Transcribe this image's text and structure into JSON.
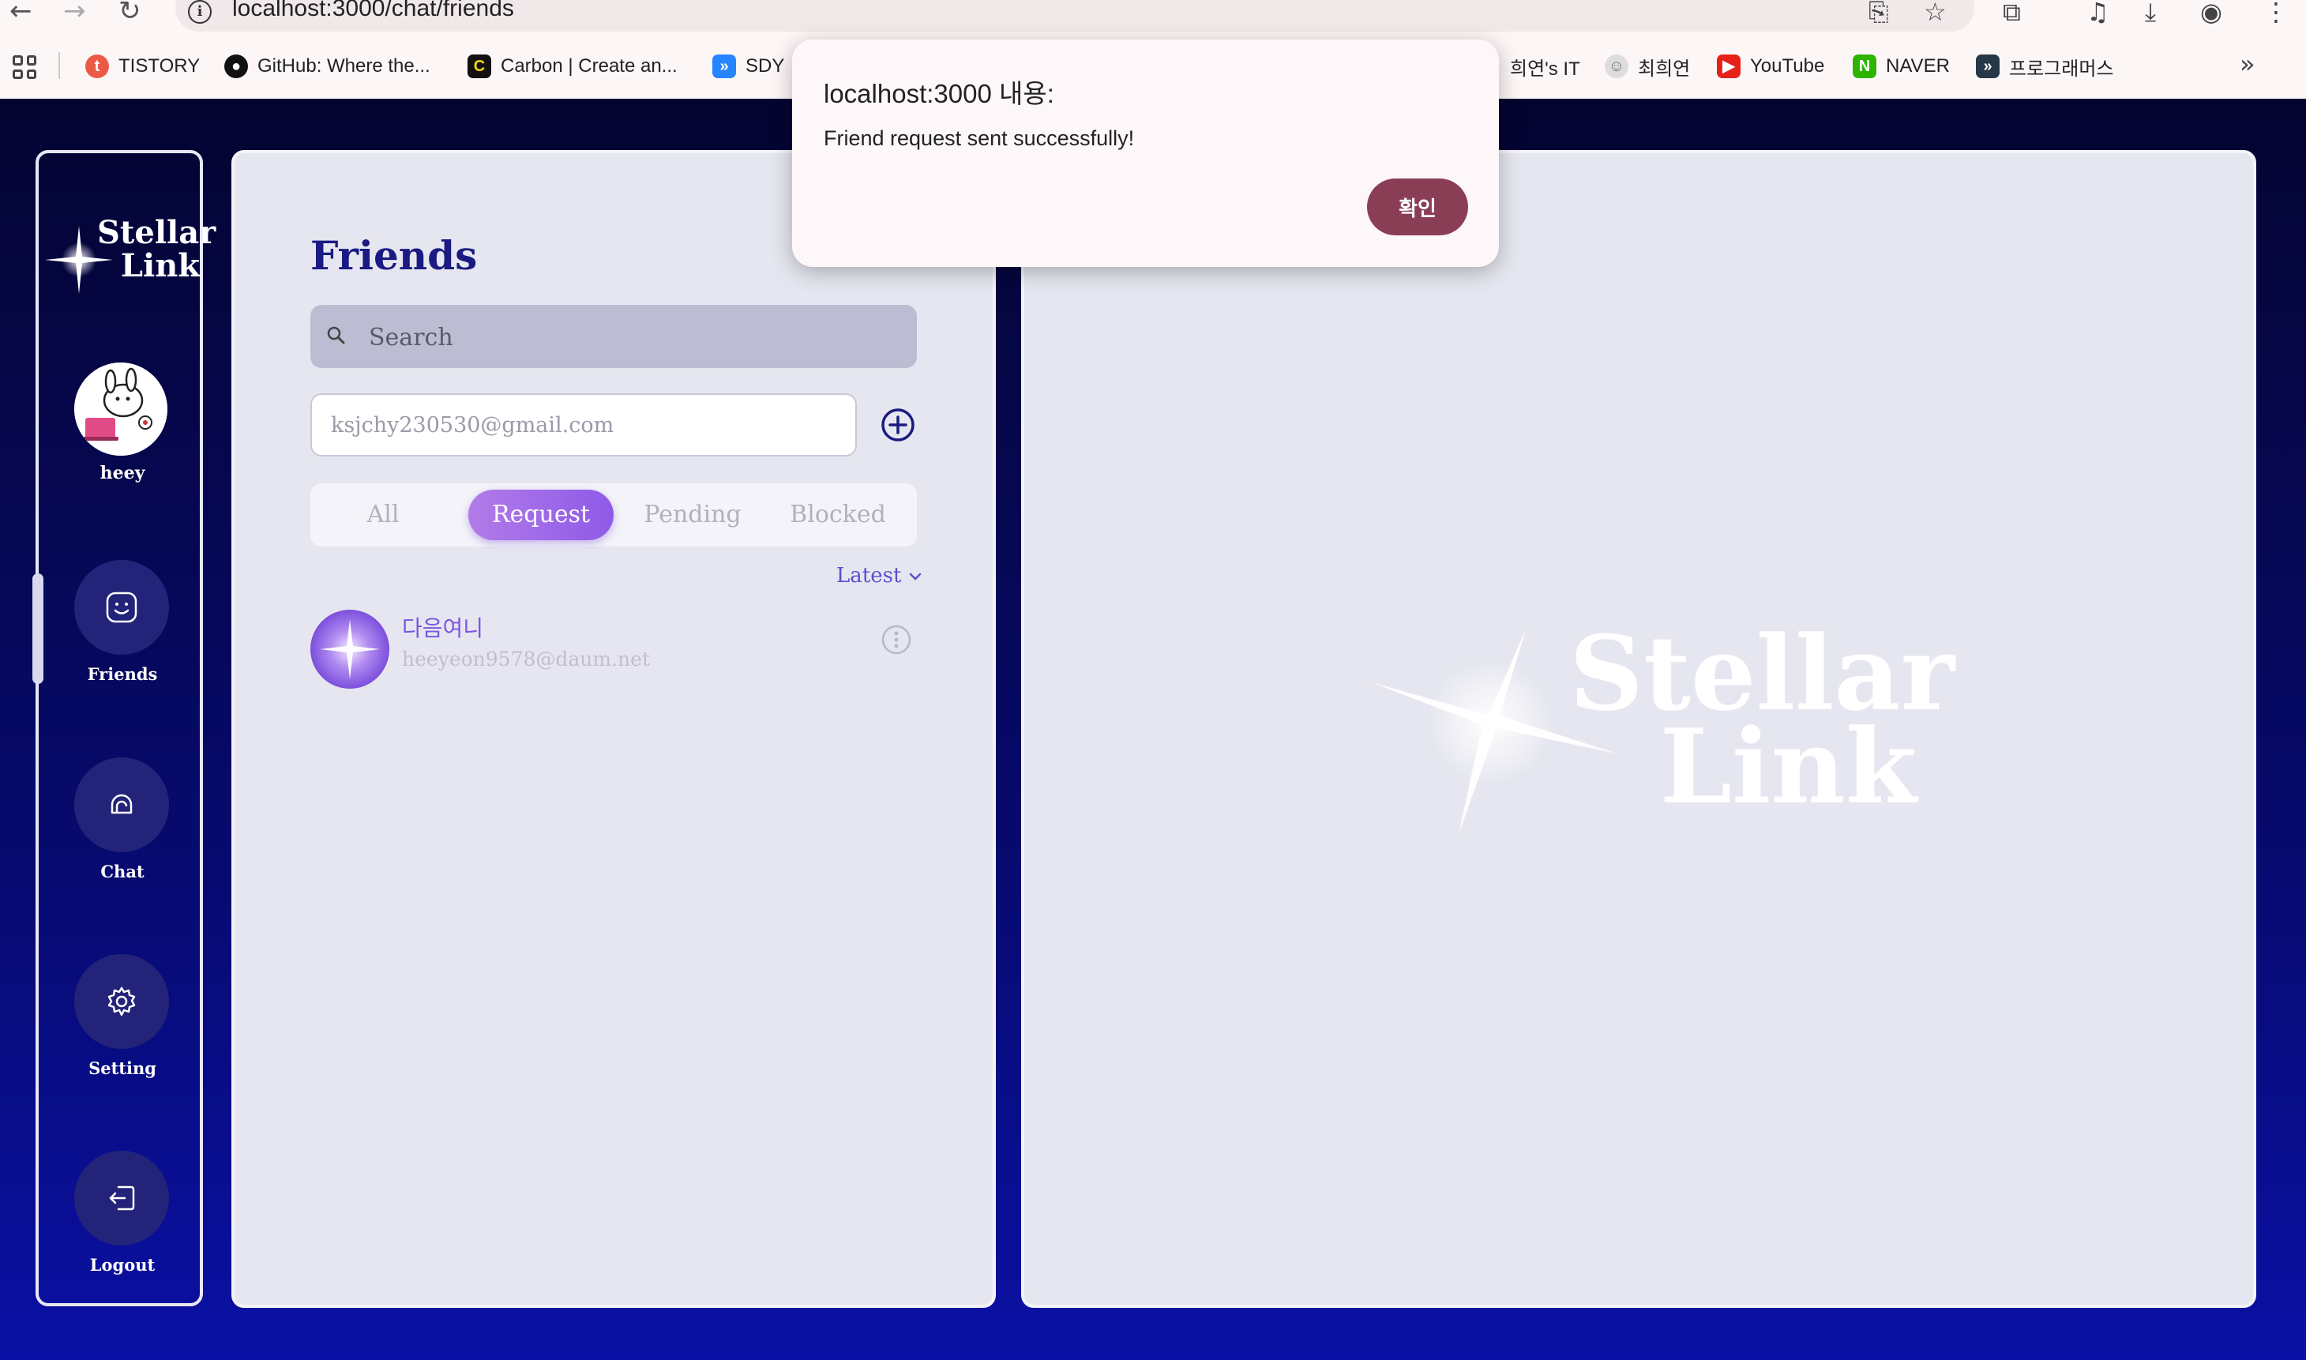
{
  "browser": {
    "url": "localhost:3000/chat/friends",
    "bookmarks": [
      {
        "label": "TISTORY",
        "icon": "tistory-icon",
        "color": "#eb5a47"
      },
      {
        "label": "GitHub: Where the...",
        "icon": "github-icon",
        "color": "#111111"
      },
      {
        "label": "Carbon | Create an...",
        "icon": "carbon-icon",
        "color": "#111111"
      },
      {
        "label": "SDY",
        "icon": "jira-icon",
        "color": "#2684ff"
      },
      {
        "label": "희연's IT",
        "icon": "blog-icon",
        "color": "#888888"
      },
      {
        "label": "최희연",
        "icon": "profile-icon",
        "color": "#888888"
      },
      {
        "label": "YouTube",
        "icon": "youtube-icon",
        "color": "#e62117"
      },
      {
        "label": "NAVER",
        "icon": "naver-icon",
        "color": "#2db400"
      },
      {
        "label": "프로그래머스",
        "icon": "programmers-icon",
        "color": "#263747"
      }
    ]
  },
  "sidebar": {
    "logo_line1": "Stellar",
    "logo_line2": "Link",
    "user_name": "heey",
    "nav": [
      {
        "label": "Friends",
        "icon": "smile-icon",
        "active": true
      },
      {
        "label": "Chat",
        "icon": "chat-bubble-icon",
        "active": false
      },
      {
        "label": "Setting",
        "icon": "gear-icon",
        "active": false
      },
      {
        "label": "Logout",
        "icon": "logout-icon",
        "active": false
      }
    ]
  },
  "friends": {
    "title": "Friends",
    "search_placeholder": "Search",
    "email_input_value": "ksjchy230530@gmail.com",
    "tabs": [
      "All",
      "Request",
      "Pending",
      "Blocked"
    ],
    "active_tab": "Request",
    "sort_label": "Latest",
    "list": [
      {
        "name": "다음여니",
        "email": "heeyeon9578@daum.net"
      }
    ]
  },
  "chat_panel": {
    "logo_line1": "Stellar",
    "logo_line2": "Link"
  },
  "dialog": {
    "title": "localhost:3000 내용:",
    "message": "Friend request sent successfully!",
    "ok_label": "확인"
  },
  "colors": {
    "accent": "#1a1a82",
    "tab_active": "#9b66e8",
    "dialog_button": "#8a3e56"
  }
}
